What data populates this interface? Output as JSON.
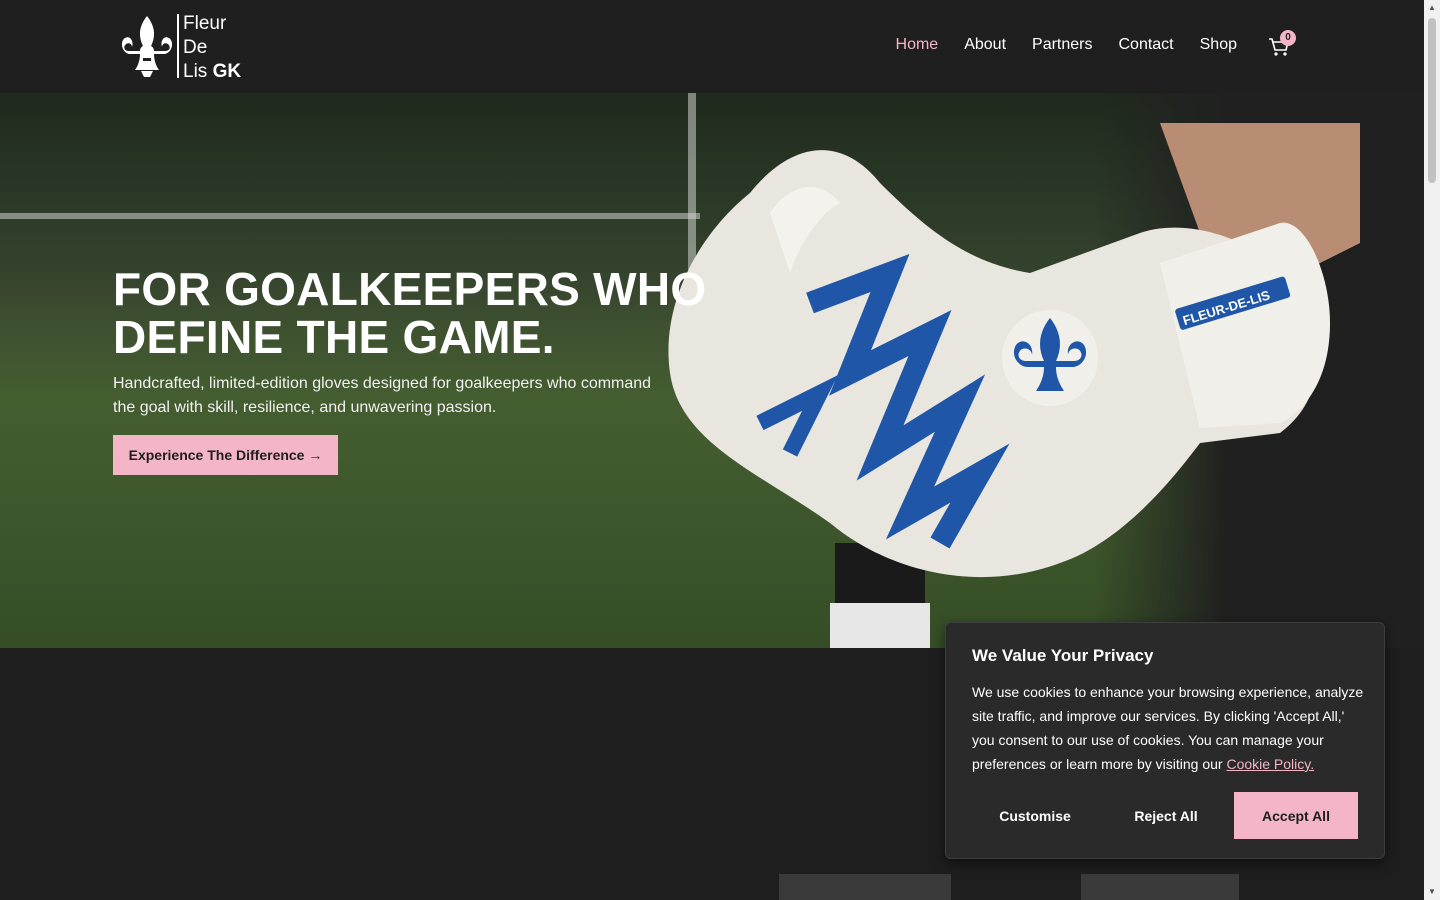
{
  "brand": {
    "line1": "Fleur",
    "line2": "De",
    "line3": "Lis",
    "suffix": "GK"
  },
  "nav": {
    "items": [
      "Home",
      "About",
      "Partners",
      "Contact",
      "Shop"
    ],
    "active": "Home",
    "cart_count": "0"
  },
  "hero": {
    "title_line1": "FOR GOALKEEPERS WHO",
    "title_line2": "DEFINE THE GAME.",
    "subtitle": "Handcrafted, limited-edition gloves designed for goalkeepers who command the goal with skill, resilience, and unwavering passion.",
    "cta": "Experience The Difference →",
    "glove_label": "FLEUR-DE-LIS"
  },
  "cookie": {
    "title": "We Value Your Privacy",
    "body": "We use cookies to enhance your browsing experience, analyze site traffic, and improve our services. By clicking 'Accept All,' you consent to our use of cookies. You can manage your preferences or learn more by visiting our",
    "link": "Cookie Policy.",
    "customise": "Customise",
    "reject": "Reject All",
    "accept": "Accept All"
  },
  "colors": {
    "accent": "#f4b6c6",
    "background": "#1e1e1e",
    "glove_blue": "#1f56a8"
  }
}
